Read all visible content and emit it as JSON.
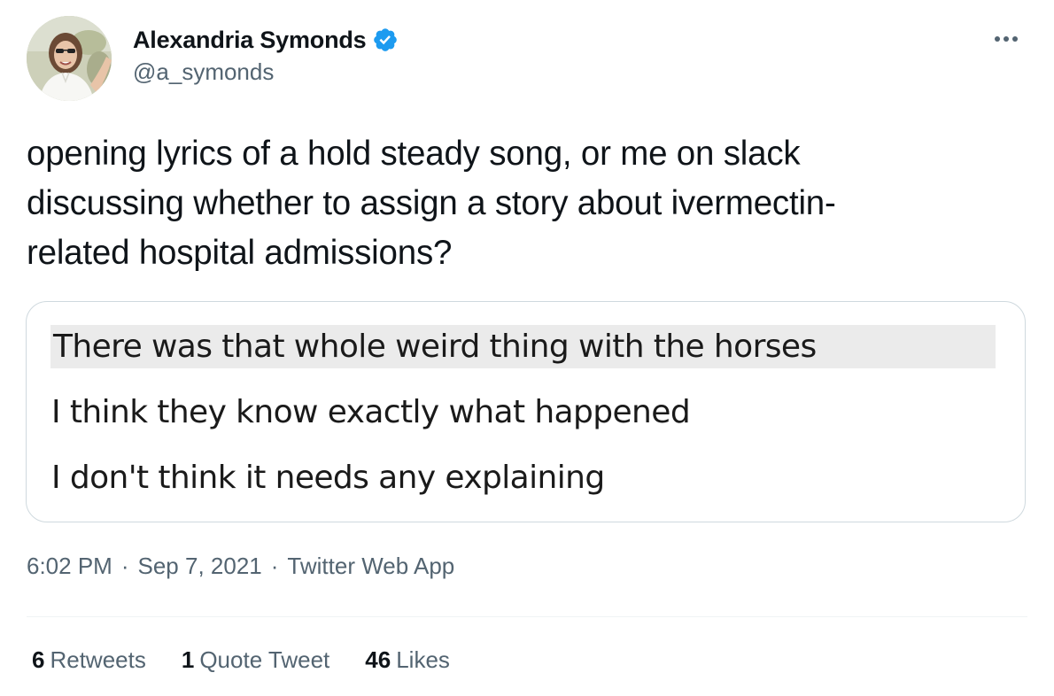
{
  "author": {
    "display_name": "Alexandria Symonds",
    "handle": "@a_symonds",
    "verified_icon": "verified-badge-icon",
    "verified_color": "#1d9bf0"
  },
  "tweet": {
    "text": "opening lyrics of a hold steady song, or me on slack\ndiscussing whether to assign a story about ivermectin-\nrelated hospital admissions?",
    "media": {
      "lines": [
        "There was that whole weird thing with the horses",
        "I think they know exactly what happened",
        "I don't think it needs any explaining"
      ]
    },
    "time": "6:02 PM",
    "date": "Sep 7, 2021",
    "source": "Twitter Web App",
    "separator": "·"
  },
  "stats": {
    "retweets": {
      "count": "6",
      "label": "Retweets"
    },
    "quote_tweets": {
      "count": "1",
      "label": "Quote Tweet"
    },
    "likes": {
      "count": "46",
      "label": "Likes"
    }
  },
  "icons": {
    "more": "more-options-icon"
  },
  "colors": {
    "primary_text": "#0f1419",
    "secondary_text": "#536471",
    "border": "#cfd9de",
    "highlight": "#ebebeb"
  }
}
